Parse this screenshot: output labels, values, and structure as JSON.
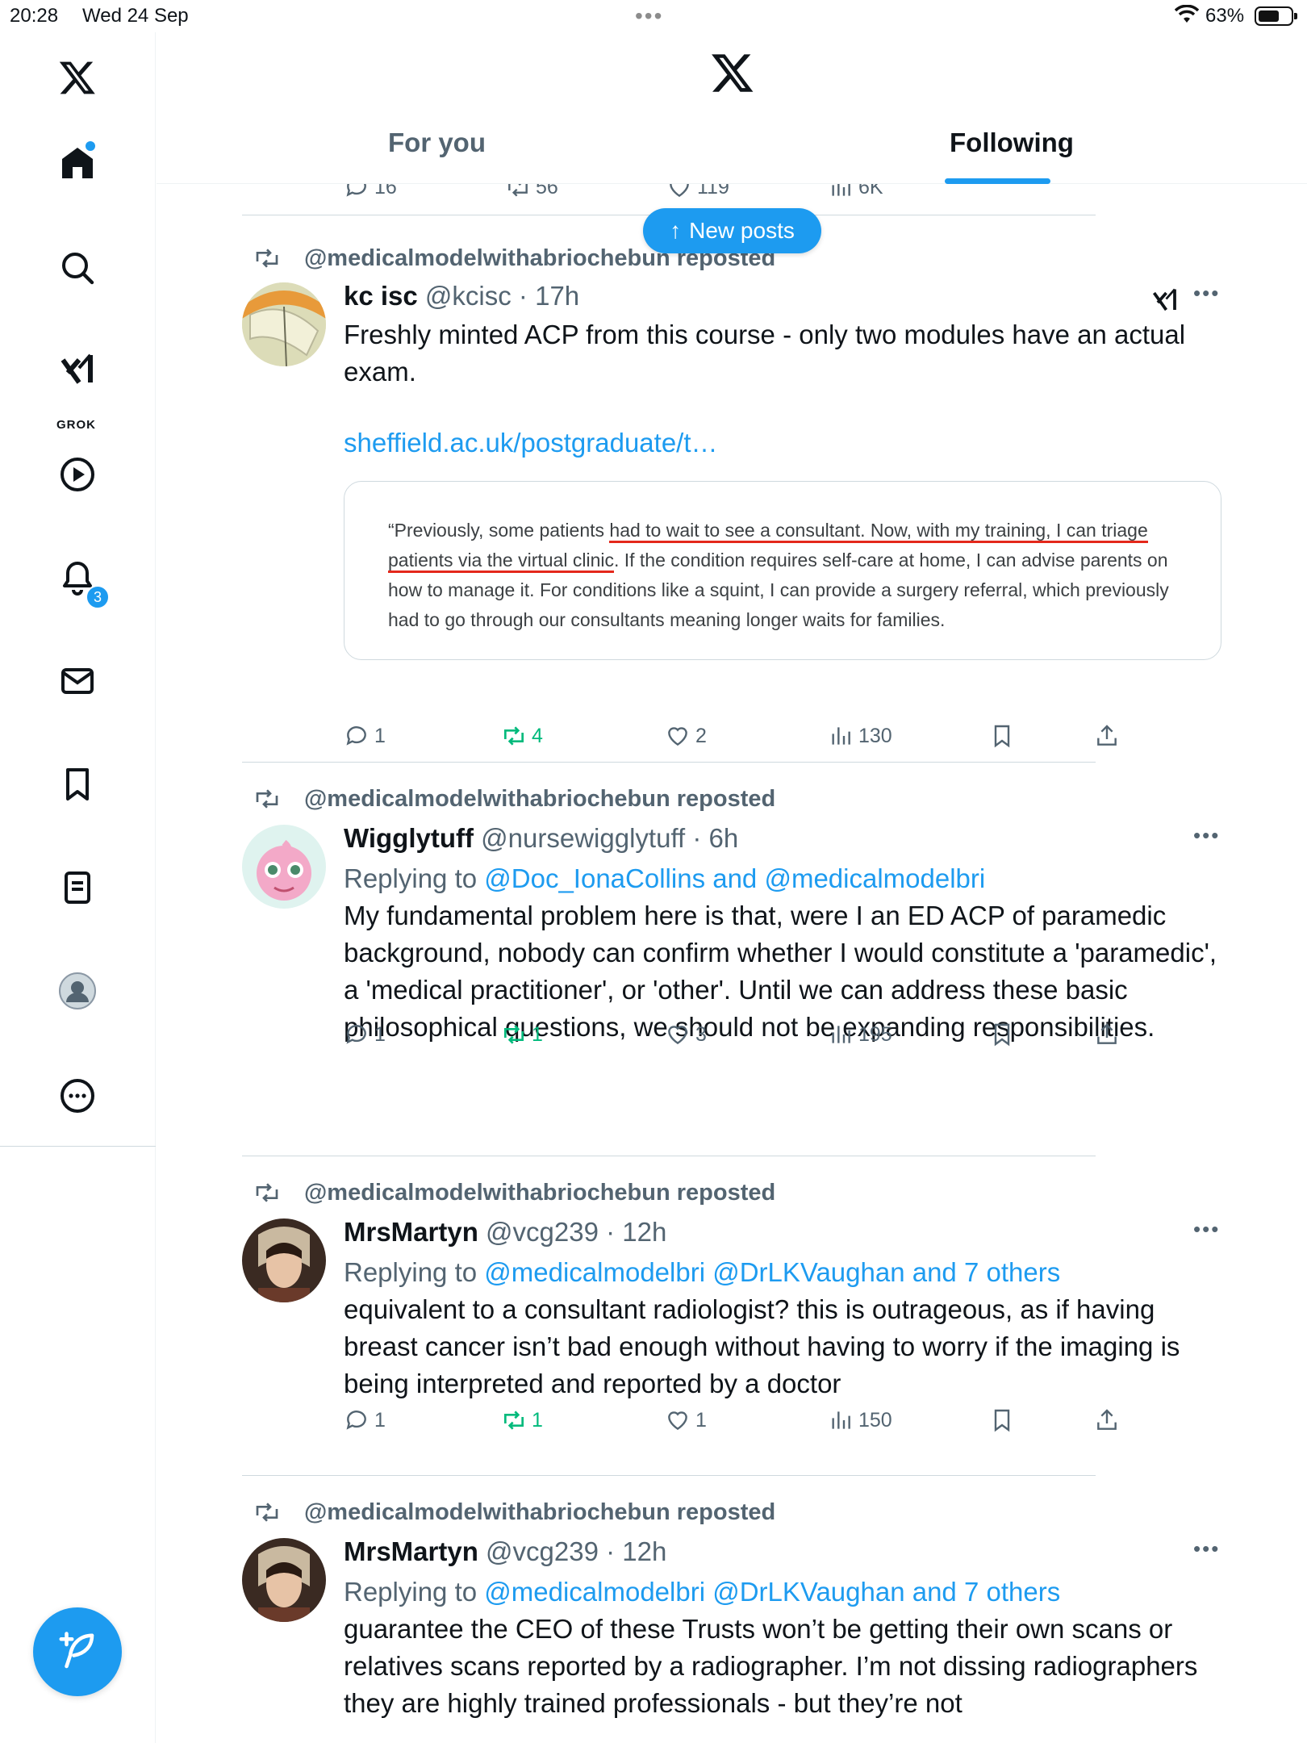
{
  "status_bar": {
    "time": "20:28",
    "date": "Wed 24 Sep",
    "battery": "63%",
    "battery_level": 0.63
  },
  "header": {
    "tabs": [
      {
        "label": "For you"
      },
      {
        "label": "Following"
      }
    ],
    "active_tab": "Following"
  },
  "sidebar": {
    "items": [
      {
        "name": "home",
        "icon": "home-icon"
      },
      {
        "name": "explore",
        "icon": "search-icon"
      },
      {
        "name": "grok",
        "icon": "grok-icon",
        "label": "GROK"
      },
      {
        "name": "video",
        "icon": "play-icon"
      },
      {
        "name": "notifications",
        "icon": "bell-icon",
        "badge": "3"
      },
      {
        "name": "messages",
        "icon": "mail-icon"
      },
      {
        "name": "bookmarks",
        "icon": "bookmark-icon"
      },
      {
        "name": "lists",
        "icon": "list-icon"
      },
      {
        "name": "profile",
        "icon": "avatar-icon"
      },
      {
        "name": "more",
        "icon": "more-icon"
      }
    ]
  },
  "new_posts": {
    "label": "New posts"
  },
  "partial_post": {
    "replies": "16",
    "reposts": "56",
    "likes": "119",
    "views": "6K"
  },
  "posts": [
    {
      "repost_by": "@medicalmodelwithabriochebun reposted",
      "name": "kc isc",
      "handle": "@kcisc",
      "time": "17h",
      "text": "Freshly minted ACP from this course  - only two modules have an actual exam.",
      "link": "sheffield.ac.uk/postgraduate/t…",
      "card": {
        "seg1": "“Previously, some patients ",
        "seg2": "had to wait to see a consultant. Now, with my training, I can tr",
        "seg3": "iage patients via the virtual clinic",
        "seg4": ". If the condition requires self-care at home, I can advise parents on how to manage it. For conditions like a squint, I can provide a surgery referral, which previously had to go through our consultants meaning longer waits for families."
      },
      "replies": "1",
      "reposts": "4",
      "likes": "2",
      "views": "130"
    },
    {
      "repost_by": "@medicalmodelwithabriochebun reposted",
      "name": "Wigglytuff",
      "handle": "@nursewigglytuff",
      "time": "6h",
      "reply_prefix": "Replying to ",
      "reply_to": "@Doc_IonaCollins and @medicalmodelbri",
      "text": "My fundamental problem here is that, were I an ED ACP of paramedic background, nobody can confirm whether I would constitute a 'paramedic', a 'medical practitioner', or 'other'. Until we can address these basic philosophical questions, we should not be expanding responsibilities.",
      "replies": "1",
      "reposts": "1",
      "likes": "3",
      "views": "195"
    },
    {
      "repost_by": "@medicalmodelwithabriochebun reposted",
      "name": "MrsMartyn",
      "handle": "@vcg239",
      "time": "12h",
      "reply_prefix": "Replying to ",
      "reply_to": "@medicalmodelbri @DrLKVaughan and 7 others",
      "text": "equivalent to a consultant radiologist? this is outrageous, as if having breast cancer isn’t bad enough without having to worry if the imaging is being interpreted and reported by a doctor",
      "replies": "1",
      "reposts": "1",
      "likes": "1",
      "views": "150"
    },
    {
      "repost_by": "@medicalmodelwithabriochebun reposted",
      "name": "MrsMartyn",
      "handle": "@vcg239",
      "time": "12h",
      "reply_prefix": "Replying to ",
      "reply_to": "@medicalmodelbri @DrLKVaughan and 7 others",
      "text": "guarantee the CEO of these Trusts won’t be getting their own scans or relatives scans reported by a radiographer. I’m not dissing radiographers they are highly trained professionals - but they’re not"
    }
  ]
}
